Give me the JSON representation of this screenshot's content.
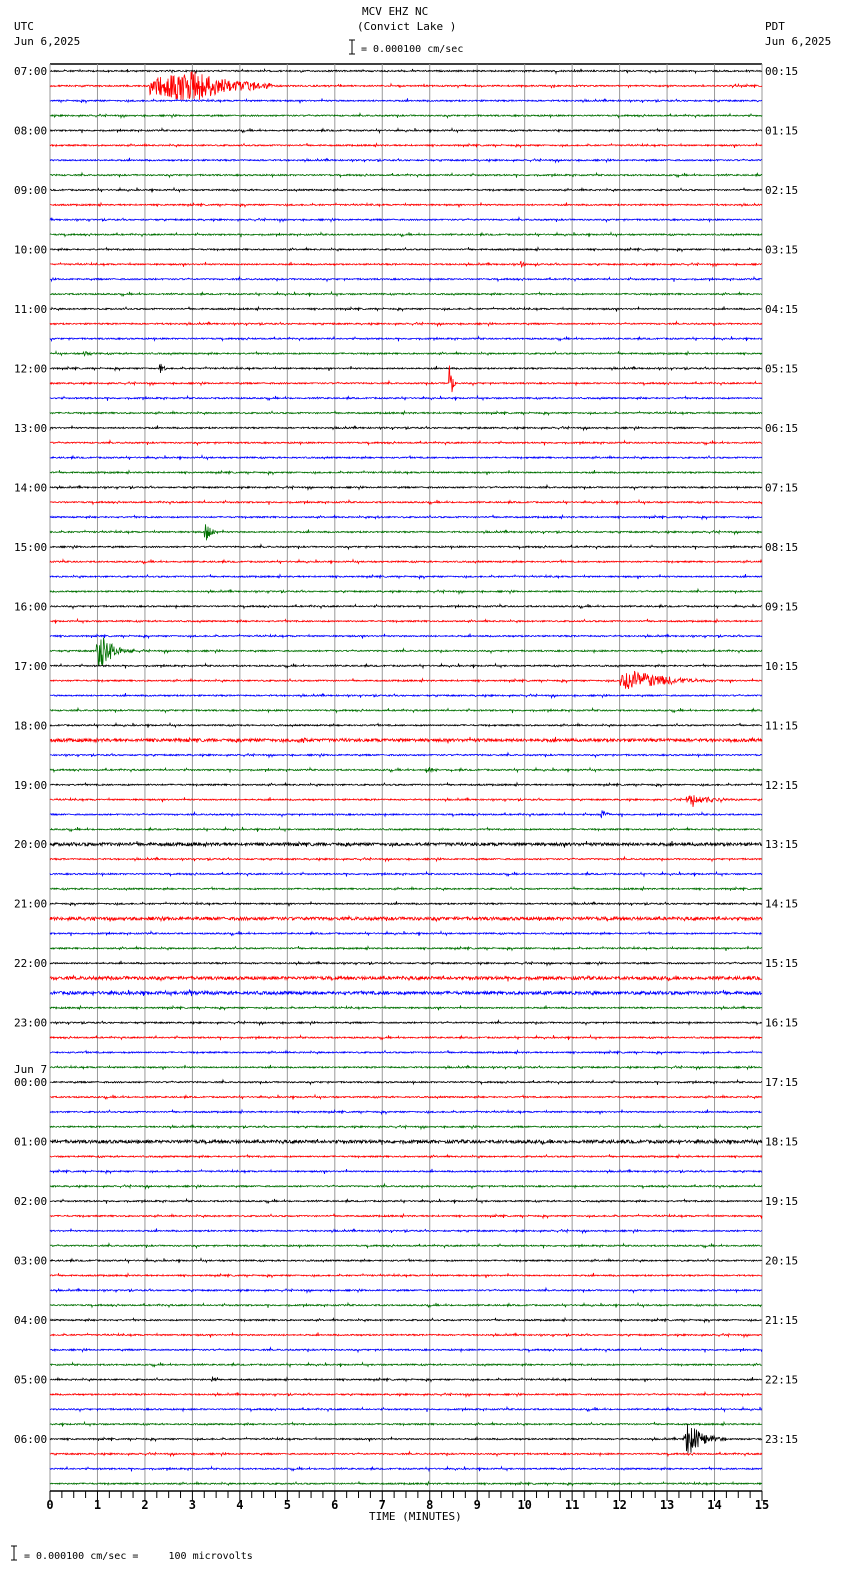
{
  "chart_data": {
    "type": "line",
    "title": "MCV EHZ NC",
    "subtitle": "(Convict Lake )",
    "scale_label": "= 0.000100 cm/sec",
    "left_header": {
      "tz": "UTC",
      "date": "Jun 6,2025"
    },
    "right_header": {
      "tz": "PDT",
      "date": "Jun 6,2025"
    },
    "xlabel": "TIME (MINUTES)",
    "xlim": [
      0,
      15
    ],
    "x_ticks": [
      "0",
      "1",
      "2",
      "3",
      "4",
      "5",
      "6",
      "7",
      "8",
      "9",
      "10",
      "11",
      "12",
      "13",
      "14",
      "15"
    ],
    "trace_minutes": 15,
    "trace_count": 96,
    "trace_colors": [
      "#000000",
      "#ff0000",
      "#0000ff",
      "#007000"
    ],
    "left_labels": [
      "07:00",
      "08:00",
      "09:00",
      "10:00",
      "11:00",
      "12:00",
      "13:00",
      "14:00",
      "15:00",
      "16:00",
      "17:00",
      "18:00",
      "19:00",
      "20:00",
      "21:00",
      "22:00",
      "23:00",
      "00:00",
      "01:00",
      "02:00",
      "03:00",
      "04:00",
      "05:00",
      "06:00"
    ],
    "date_change_label": "Jun 7",
    "right_labels": [
      "00:15",
      "01:15",
      "02:15",
      "03:15",
      "04:15",
      "05:15",
      "06:15",
      "07:15",
      "08:15",
      "09:15",
      "10:15",
      "11:15",
      "12:15",
      "13:15",
      "14:15",
      "15:15",
      "16:15",
      "17:15",
      "18:15",
      "19:15",
      "20:15",
      "21:15",
      "22:15",
      "23:15"
    ],
    "events": [
      {
        "trace": 1,
        "minute": 2.1,
        "amplitude": 16,
        "duration": 2.6,
        "peak_minute": 3.0
      },
      {
        "trace": 4,
        "minute": 10.7,
        "amplitude": 3,
        "duration": 0.1
      },
      {
        "trace": 13,
        "minute": 9.9,
        "amplitude": 4,
        "duration": 0.15
      },
      {
        "trace": 19,
        "minute": 0.7,
        "amplitude": 3,
        "duration": 0.3
      },
      {
        "trace": 20,
        "minute": 2.3,
        "amplitude": 6,
        "duration": 0.2
      },
      {
        "trace": 21,
        "minute": 8.4,
        "amplitude": 28,
        "duration": 0.15
      },
      {
        "trace": 30,
        "minute": 6.85,
        "amplitude": 6,
        "duration": 0.15
      },
      {
        "trace": 31,
        "minute": 3.25,
        "amplitude": 11,
        "duration": 0.3
      },
      {
        "trace": 39,
        "minute": 0.97,
        "amplitude": 18,
        "duration": 0.8
      },
      {
        "trace": 41,
        "minute": 12.0,
        "amplitude": 11,
        "duration": 2.2
      },
      {
        "trace": 45,
        "minute": 5.2,
        "amplitude": 4,
        "duration": 0.3
      },
      {
        "trace": 47,
        "minute": 7.9,
        "amplitude": 4,
        "duration": 0.4
      },
      {
        "trace": 49,
        "minute": 13.4,
        "amplitude": 6,
        "duration": 1.2
      },
      {
        "trace": 50,
        "minute": 11.6,
        "amplitude": 5,
        "duration": 0.3
      },
      {
        "trace": 62,
        "minute": 2.9,
        "amplitude": 4,
        "duration": 0.5
      },
      {
        "trace": 88,
        "minute": 3.4,
        "amplitude": 4,
        "duration": 0.1
      },
      {
        "trace": 92,
        "minute": 13.35,
        "amplitude": 17,
        "duration": 0.9
      }
    ],
    "noisy_traces": [
      45,
      52,
      57,
      61,
      62,
      72
    ],
    "grid": true
  },
  "footer": {
    "scale_text": "= 0.000100 cm/sec =     100 microvolts"
  }
}
